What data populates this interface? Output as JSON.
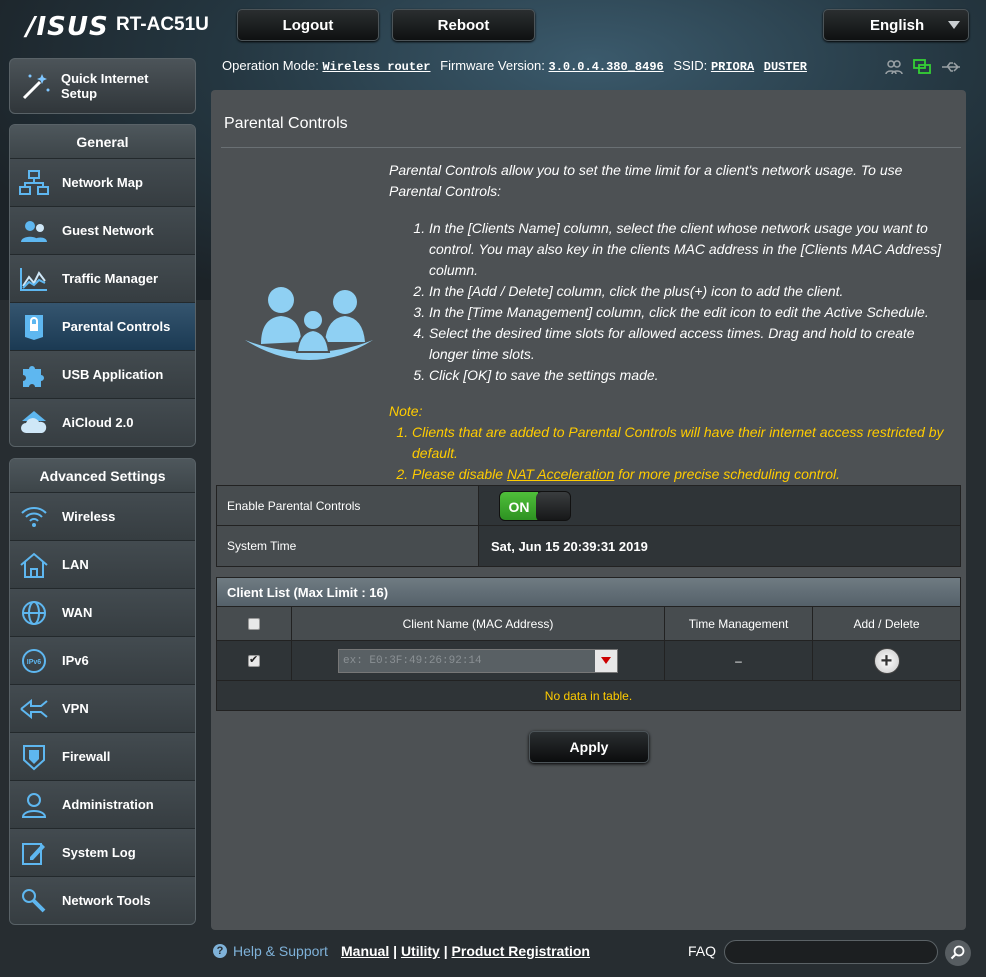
{
  "header": {
    "brand": "/ISUS",
    "model": "RT-AC51U",
    "logout_label": "Logout",
    "reboot_label": "Reboot",
    "language": "English"
  },
  "status": {
    "operation_mode_label": "Operation Mode:",
    "operation_mode": "Wireless router",
    "firmware_label": "Firmware Version:",
    "firmware": "3.0.0.4.380_8496",
    "ssid_label": "SSID:",
    "ssid_1": "PRIORA",
    "ssid_2": "DUSTER"
  },
  "sidebar": {
    "quick_setup": "Quick Internet Setup",
    "general_title": "General",
    "general_items": [
      {
        "label": "Network Map",
        "icon": "network-map-icon"
      },
      {
        "label": "Guest Network",
        "icon": "guest-network-icon"
      },
      {
        "label": "Traffic Manager",
        "icon": "traffic-manager-icon"
      },
      {
        "label": "Parental Controls",
        "icon": "parental-controls-icon",
        "active": true
      },
      {
        "label": "USB Application",
        "icon": "usb-application-icon"
      },
      {
        "label": "AiCloud 2.0",
        "icon": "aicloud-icon"
      }
    ],
    "advanced_title": "Advanced Settings",
    "advanced_items": [
      {
        "label": "Wireless",
        "icon": "wireless-icon"
      },
      {
        "label": "LAN",
        "icon": "lan-icon"
      },
      {
        "label": "WAN",
        "icon": "wan-icon"
      },
      {
        "label": "IPv6",
        "icon": "ipv6-icon"
      },
      {
        "label": "VPN",
        "icon": "vpn-icon"
      },
      {
        "label": "Firewall",
        "icon": "firewall-icon"
      },
      {
        "label": "Administration",
        "icon": "administration-icon"
      },
      {
        "label": "System Log",
        "icon": "system-log-icon"
      },
      {
        "label": "Network Tools",
        "icon": "network-tools-icon"
      }
    ]
  },
  "main": {
    "title": "Parental Controls",
    "intro": "Parental Controls allow you to set the time limit for a client's network usage. To use Parental Controls:",
    "steps": [
      "In the [Clients Name] column, select the client whose network usage you want to control. You may also key in the clients MAC address in the [Clients MAC Address] column.",
      "In the [Add / Delete] column, click the plus(+) icon to add the client.",
      "In the [Time Management] column, click the edit icon to edit the Active Schedule.",
      "Select the desired time slots for allowed access times. Drag and hold to create longer time slots.",
      "Click [OK] to save the settings made."
    ],
    "note_title": "Note:",
    "note_1": "Clients that are added to Parental Controls will have their internet access restricted by default.",
    "note_2_prefix": "Please disable",
    "note_2_link": "NAT Acceleration",
    "note_2_suffix": "for more precise scheduling control.",
    "enable_label": "Enable Parental Controls",
    "toggle_state": "ON",
    "system_time_label": "System Time",
    "system_time": "Sat, Jun 15 20:39:31 2019",
    "client_list_title": "Client List (Max Limit : 16)",
    "col_name": "Client Name (MAC Address)",
    "col_time": "Time Management",
    "col_add": "Add / Delete",
    "mac_placeholder": "ex: E0:3F:49:26:92:14",
    "time_mgmt_value": "–",
    "no_data": "No data in table.",
    "apply_label": "Apply"
  },
  "footer": {
    "help": "Help & Support",
    "manual": "Manual",
    "utility": "Utility",
    "registration": "Product Registration",
    "faq": "FAQ"
  }
}
